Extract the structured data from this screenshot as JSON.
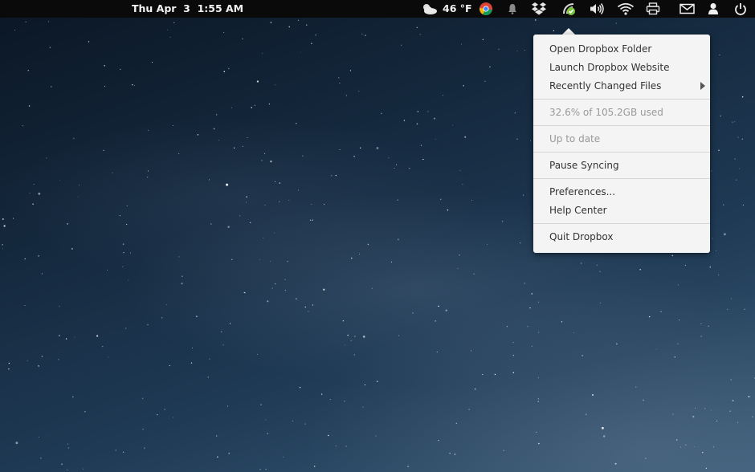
{
  "panel": {
    "clock": "Thu Apr  3  1:55 AM",
    "weather": {
      "icon": "partly-cloudy-icon",
      "temperature": "46 °F"
    },
    "tray_icons": [
      "chrome-icon",
      "notification-bell-icon",
      "dropbox-icon",
      "dropbox-sync-icon",
      "volume-icon",
      "wifi-icon",
      "printer-icon",
      "mail-icon",
      "user-icon",
      "power-icon"
    ]
  },
  "dropbox_menu": {
    "open_folder": "Open Dropbox Folder",
    "launch_website": "Launch Dropbox Website",
    "recently_changed": "Recently Changed Files",
    "usage": "32.6% of 105.2GB used",
    "status": "Up to date",
    "pause_syncing": "Pause Syncing",
    "preferences": "Preferences...",
    "help_center": "Help Center",
    "quit": "Quit Dropbox"
  },
  "colors": {
    "panel_bg": "#0a0a0a",
    "menu_bg": "#f4f4f4",
    "menu_text": "#333333",
    "menu_disabled_text": "#999999",
    "dropbox_blue": "#007ee5",
    "sync_green": "#7cc242"
  }
}
